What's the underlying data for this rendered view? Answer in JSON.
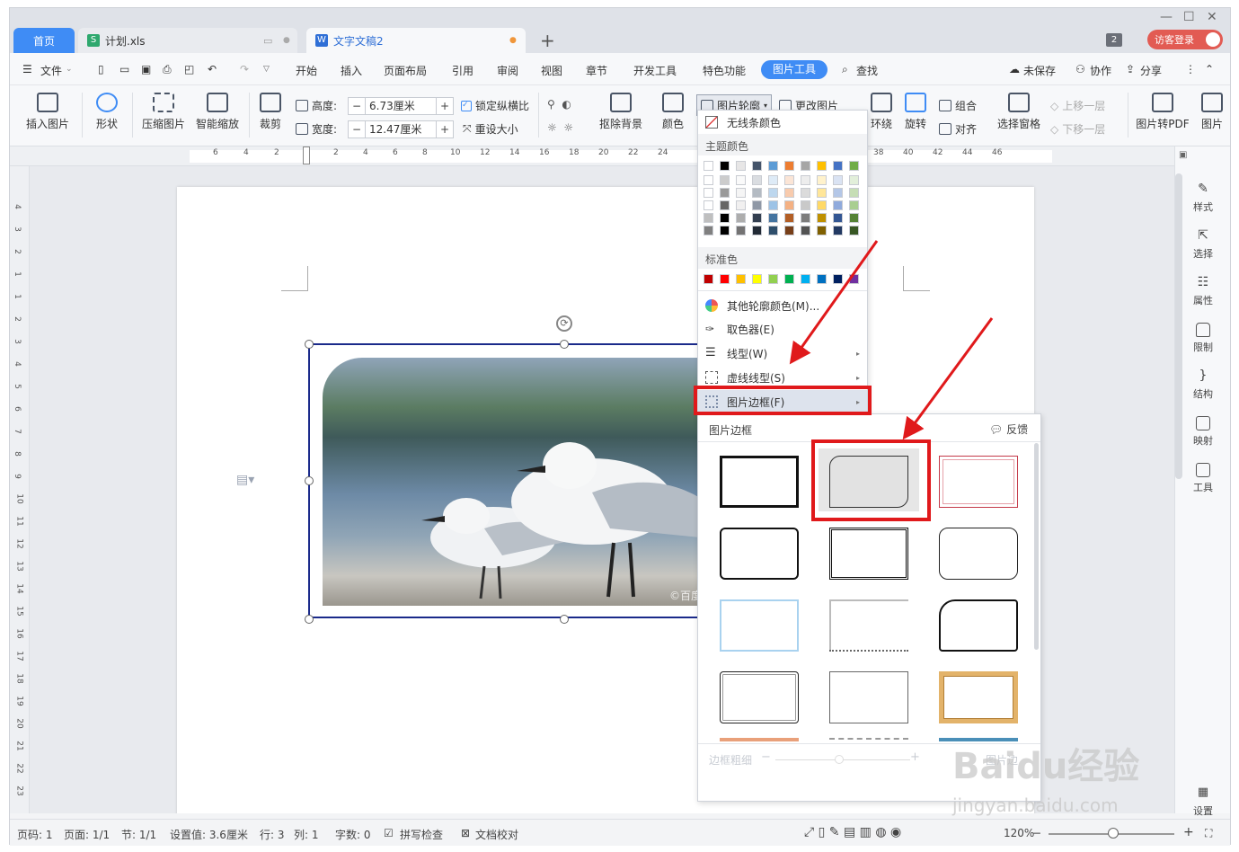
{
  "tabs": {
    "home": "首页",
    "xls": "计划.xls",
    "doc": "文字文稿2",
    "count": "2",
    "guest_login": "访客登录"
  },
  "menu": {
    "file": "文件",
    "items": [
      "开始",
      "插入",
      "页面布局",
      "引用",
      "审阅",
      "视图",
      "章节",
      "开发工具",
      "特色功能"
    ],
    "picture_tools": "图片工具",
    "search": "查找",
    "unsaved": "未保存",
    "collab": "协作",
    "share": "分享"
  },
  "ribbon": {
    "insert_picture": "插入图片",
    "shape": "形状",
    "compress": "压缩图片",
    "smart_scale": "智能缩放",
    "crop": "裁剪",
    "height_label": "高度:",
    "height_value": "6.73厘米",
    "width_label": "宽度:",
    "width_value": "12.47厘米",
    "lock_ratio": "锁定纵横比",
    "reset_size": "重设大小",
    "remove_bg": "抠除背景",
    "color": "颜色",
    "outline": "图片轮廓",
    "change_pic": "更改图片",
    "wrap": "环绕",
    "rotate": "旋转",
    "group": "组合",
    "align": "对齐",
    "select_pane": "选择窗格",
    "bring_forward": "上移一层",
    "send_backward": "下移一层",
    "to_pdf": "图片转PDF",
    "pic_more": "图片"
  },
  "ruler": {
    "marks": [
      "6",
      "4",
      "2",
      "2",
      "4",
      "6",
      "8",
      "10",
      "12",
      "14",
      "16",
      "18",
      "20",
      "22",
      "24",
      "38",
      "40",
      "42",
      "44",
      "46"
    ],
    "vmarks": [
      "4",
      "3",
      "2",
      "1",
      "1",
      "2",
      "3",
      "4",
      "5",
      "6",
      "7",
      "8",
      "9",
      "10",
      "11",
      "12",
      "13",
      "14",
      "15",
      "16",
      "17",
      "18",
      "19",
      "20",
      "21",
      "22",
      "23"
    ]
  },
  "outline_menu": {
    "no_line": "无线条颜色",
    "theme_colors": "主题颜色",
    "standard_colors": "标准色",
    "more_colors": "其他轮廓颜色(M)...",
    "picker": "取色器(E)",
    "line_style": "线型(W)",
    "dash_style": "虚线线型(S)",
    "picture_border": "图片边框(F)",
    "theme_row": [
      "#ffffff",
      "#000000",
      "#e7e6e6",
      "#44546a",
      "#5b9bd5",
      "#ed7d31",
      "#a5a5a5",
      "#ffc000",
      "#4472c4",
      "#70ad47"
    ],
    "standard_row": [
      "#c00000",
      "#ff0000",
      "#ffc000",
      "#ffff00",
      "#92d050",
      "#00b050",
      "#00b0f0",
      "#0070c0",
      "#002060",
      "#7030a0"
    ]
  },
  "border_panel": {
    "title": "图片边框",
    "feedback": "反馈",
    "thickness": "边框粗细",
    "picture_more": "图片边"
  },
  "sidebar": [
    "样式",
    "选择",
    "属性",
    "限制",
    "结构",
    "映射",
    "工具",
    "设置"
  ],
  "status": {
    "page_no": "页码: 1",
    "pages": "页面: 1/1",
    "section": "节: 1/1",
    "setting": "设置值: 3.6厘米",
    "row": "行: 3",
    "col": "列: 1",
    "words": "字数: 0",
    "spell": "拼写检查",
    "proof": "文档校对",
    "zoom": "120%"
  },
  "watermark": {
    "brand": "Baidu经验",
    "url": "jingyan.baidu.com",
    "photo_credit": "©百度"
  }
}
